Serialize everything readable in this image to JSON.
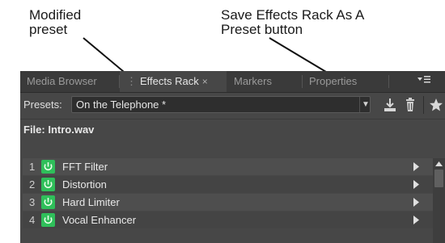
{
  "callouts": {
    "modified_preset": "Modified\npreset",
    "save_button": "Save Effects Rack As A\nPreset button"
  },
  "tabs": [
    {
      "label": "Media Browser",
      "active": false
    },
    {
      "label": "Effects Rack",
      "active": true,
      "close": "×"
    },
    {
      "label": "Markers",
      "active": false
    },
    {
      "label": "Properties",
      "active": false
    }
  ],
  "panel_menu_icon": "panel-menu-icon",
  "presets": {
    "label": "Presets:",
    "value": "On the Telephone *"
  },
  "toolbar_icons": [
    "save-preset-icon",
    "delete-preset-icon",
    "favorite-star-icon"
  ],
  "file": {
    "label": "File: Intro.wav"
  },
  "rack": [
    {
      "num": "1",
      "name": "FFT Filter"
    },
    {
      "num": "2",
      "name": "Distortion"
    },
    {
      "num": "3",
      "name": "Hard Limiter"
    },
    {
      "num": "4",
      "name": "Vocal Enhancer"
    }
  ],
  "colors": {
    "panel_bg": "#474747",
    "power_green": "#2fbf5a",
    "row_even": "#4c4c4c",
    "row_odd": "#444444"
  }
}
